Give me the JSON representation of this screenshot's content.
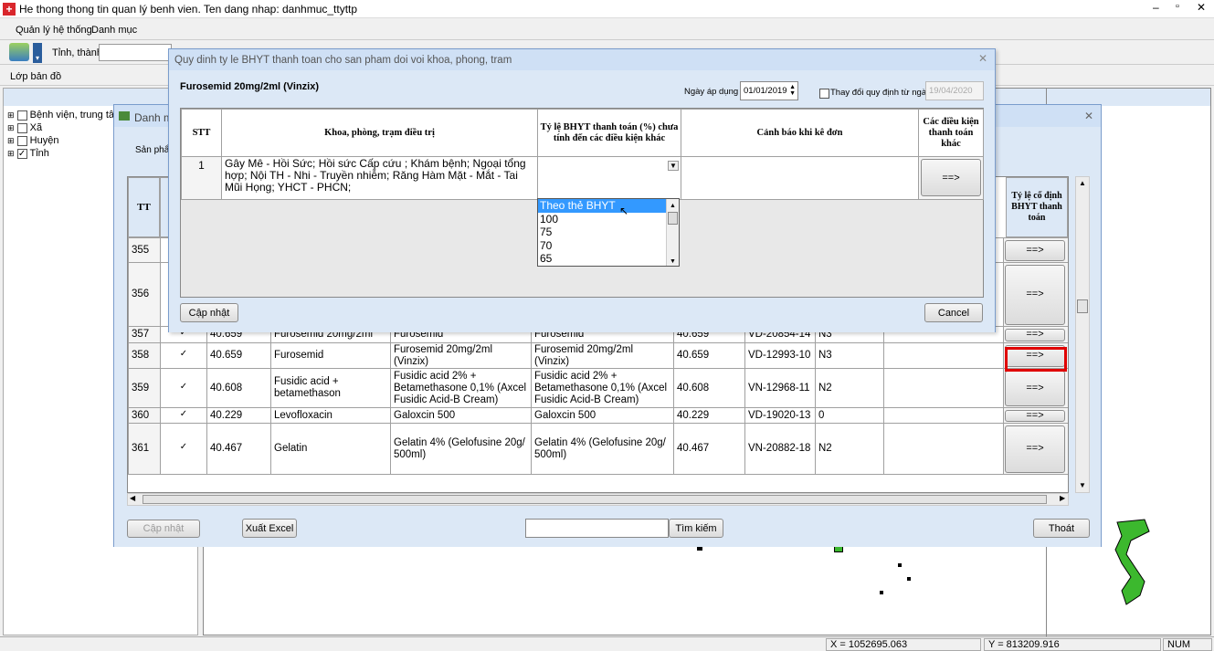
{
  "app": {
    "title": "He thong thong tin quan lý benh vien. Ten dang nhap: danhmuc_ttyttp",
    "menu": [
      "Quản lý hệ thống",
      "Danh mục"
    ],
    "province_label": "Tỉnh, thành:",
    "layers_label": "Lớp bản đồ"
  },
  "tree": [
    {
      "label": "Bệnh viện, trung tâm",
      "checked": false
    },
    {
      "label": "Xã",
      "checked": false
    },
    {
      "label": "Huyện",
      "checked": false
    },
    {
      "label": "Tỉnh",
      "checked": true
    }
  ],
  "back": {
    "title": "Danh m",
    "filter_label": "Sản phẩm",
    "header_tt": "TT",
    "header_last": "Tỷ lệ cố định BHYT thanh toán",
    "rows": [
      {
        "tt": "355",
        "checked": false,
        "code": "",
        "name": "",
        "active": "",
        "product": "",
        "code2": "",
        "reg": "",
        "group": "",
        "note": "",
        "action": "==>"
      },
      {
        "tt": "356",
        "checked": false,
        "code": "",
        "name": "",
        "active": "",
        "product": "",
        "code2": "",
        "reg": "",
        "group": "",
        "note": "",
        "action": "==>"
      },
      {
        "tt": "357",
        "checked": true,
        "code": "40.659",
        "name": "Furosemid 20mg/2ml",
        "active": "Furosemid",
        "product": "Furosemid",
        "code2": "40.659",
        "reg": "VD-20854-14",
        "group": "N3",
        "note": "",
        "action": "==>"
      },
      {
        "tt": "358",
        "checked": true,
        "code": "40.659",
        "name": "Furosemid",
        "active": "Furosemid 20mg/2ml (Vinzix)",
        "product": "Furosemid 20mg/2ml (Vinzix)",
        "code2": "40.659",
        "reg": "VD-12993-10",
        "group": "N3",
        "note": "",
        "action": "==>"
      },
      {
        "tt": "359",
        "checked": true,
        "code": "40.608",
        "name": "Fusidic acid + betamethason",
        "active": "Fusidic acid 2% + Betamethasone 0,1% (Axcel Fusidic Acid-B Cream)",
        "product": "Fusidic acid 2% + Betamethasone 0,1% (Axcel Fusidic Acid-B Cream)",
        "code2": "40.608",
        "reg": "VN-12968-11",
        "group": "N2",
        "note": "",
        "action": "==>"
      },
      {
        "tt": "360",
        "checked": true,
        "code": "40.229",
        "name": "Levofloxacin",
        "active": "Galoxcin 500",
        "product": "Galoxcin 500",
        "code2": "40.229",
        "reg": "VD-19020-13",
        "group": "0",
        "note": "",
        "action": "==>"
      },
      {
        "tt": "361",
        "checked": true,
        "code": "40.467",
        "name": "Gelatin",
        "active": "Gelatin 4% (Gelofusine 20g/ 500ml)",
        "product": "Gelatin 4% (Gelofusine 20g/ 500ml)",
        "code2": "40.467",
        "reg": "VN-20882-18",
        "group": "N2",
        "note": "",
        "action": "==>"
      }
    ],
    "update_btn": "Cập nhật",
    "export_btn": "Xuất Excel",
    "search_btn": "Tìm kiếm",
    "search_value": "",
    "exit_btn": "Thoát"
  },
  "dialog": {
    "title": "Quy dinh ty le BHYT thanh toan  cho san pham doi voi  khoa, phong, tram",
    "product": "Furosemid 20mg/2ml (Vinzix)",
    "date_label": "Ngày áp dụng",
    "date_value": "01/01/2019",
    "change_label": "Thay đổi quy định từ ngày",
    "change_date": "19/04/2020",
    "headers": [
      "STT",
      "Khoa, phòng, trạm điều trị",
      "Tỷ lệ BHYT thanh toán (%) chưa tính đến các điều kiện khác",
      "Cảnh báo khi kê đơn",
      "Các điều kiện thanh toán khác"
    ],
    "row": {
      "stt": "1",
      "dept": "Gây Mê - Hồi Sức; Hồi sức Cấp cứu ; Khám bệnh; Ngoại tổng hợp; Nội TH - Nhi - Truyền nhiễm; Răng Hàm Mặt - Mắt - Tai Mũi Họng; YHCT - PHCN;",
      "rate": "",
      "warning": "",
      "action": "==>"
    },
    "options": [
      "Theo thẻ BHYT",
      "100",
      "75",
      "70",
      "65"
    ],
    "update_btn": "Cập nhật",
    "cancel_btn": "Cancel"
  },
  "status": {
    "x": "X = 1052695.063",
    "y": "Y = 813209.916",
    "num": "NUM"
  }
}
